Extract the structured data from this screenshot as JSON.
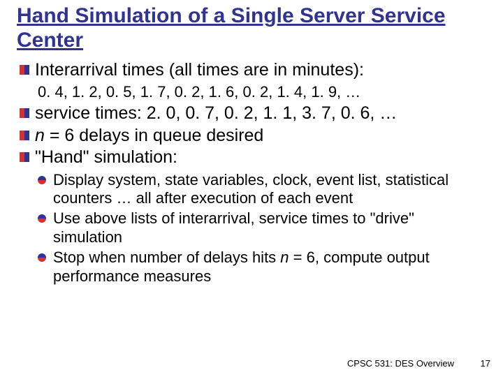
{
  "title": "Hand Simulation of a Single Server Service Center",
  "bullets": [
    {
      "text": "Interarrival times (all times are in minutes):",
      "sub_text": "0. 4, 1. 2, 0. 5, 1. 7, 0. 2, 1. 6, 0. 2, 1. 4, 1. 9, …"
    },
    {
      "text": "service times: 2. 0, 0. 7, 0. 2, 1. 1, 3. 7, 0. 6, …"
    },
    {
      "html_parts": {
        "prefix": "",
        "italic": "n",
        "rest": " = 6 delays in queue desired"
      }
    },
    {
      "text": "\"Hand\" simulation:",
      "children": [
        "Display system, state variables, clock, event list, statistical counters  … all after execution of each event",
        "Use above lists of interarrival, service times to \"drive\" simulation",
        {
          "prefix": "Stop when number of delays hits ",
          "italic": "n",
          "rest": " = 6, compute output performance measures"
        }
      ]
    }
  ],
  "footer": "CPSC 531: DES Overview",
  "page_number": "17"
}
